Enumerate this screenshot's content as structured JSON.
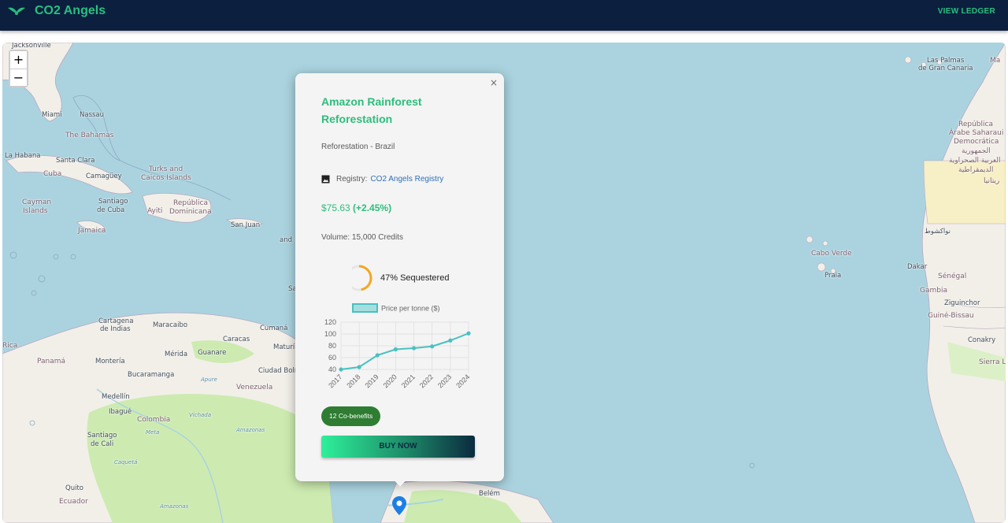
{
  "app": {
    "title": "CO2 Angels",
    "nav_link": "VIEW LEDGER",
    "brand_color": "#27c07f",
    "header_bg": "#0d1f3f"
  },
  "map": {
    "zoom_in": "+",
    "zoom_out": "−",
    "places": {
      "jacksonville": "Jacksonville",
      "miami": "Miami",
      "nassau": "Nassau",
      "bahamas": "The Bahamas",
      "la_habana": "La Habana",
      "santa_clara": "Santa Clara",
      "cuba": "Cuba",
      "camaguey": "Camagüey",
      "turks_1": "Turks and",
      "turks_2": "Caicos Islands",
      "cayman_1": "Cayman",
      "cayman_2": "Islands",
      "santiago_cuba_1": "Santiago",
      "santiago_cuba_2": "de Cuba",
      "jamaica": "Jamaica",
      "haiti": "Ayiti",
      "dominicana_1": "República",
      "dominicana_2": "Dominicana",
      "san_juan": "San Juan",
      "and": "and",
      "cartagena_1": "Cartagena",
      "cartagena_2": "de Indias",
      "maracaibo": "Maracaibo",
      "caracas": "Caracas",
      "cumana": "Cumaná",
      "panama": "Panamá",
      "rica": "Rica",
      "monteria": "Montería",
      "merida": "Mérida",
      "guanare": "Guanare",
      "maturin": "Maturín",
      "ciudad_bolivar": "Ciudad Bolív",
      "bucaramanga": "Bucaramanga",
      "apure": "Apure",
      "venezuela": "Venezuela",
      "medellin": "Medellín",
      "ibague": "Ibagué",
      "colombia": "Colombia",
      "vichada": "Vichada",
      "santiago_cali_1": "Santiago",
      "santiago_cali_2": "de Cali",
      "meta": "Meta",
      "amazonas": "Amazonas",
      "caqueta": "Caquetá",
      "quito": "Quito",
      "ecuador": "Ecuador",
      "amazonas_2": "Amazonas",
      "belem": "Belém",
      "las_palmas_1": "Las Palmas",
      "las_palmas_2": "de Gran Canaria",
      "ma": "Ma",
      "republica_1": "República",
      "republica_2": "Árabe Saharaui",
      "republica_3": "Democrática",
      "arabic_1": "الجمهورية",
      "arabic_2": "العربية الصحراوية",
      "arabic_3": "الديمقراطية",
      "arabic_4": "ريتانيا",
      "nouakchott": "نواكشوط",
      "cabo_verde": "Cabo Verde",
      "praia": "Praia",
      "dakar": "Dakar",
      "senegal": "Sénégal",
      "gambia": "Gambia",
      "ziguinchor": "Ziguinchor",
      "guine_bissau": "Guiné-Bissau",
      "conakry": "Conakry",
      "sierra_leo": "Sierra Le",
      "sa": "Sa"
    }
  },
  "popup": {
    "close": "×",
    "title": "Amazon Rainforest Reforestation",
    "subtitle": "Reforestation - Brazil",
    "registry_label": "Registry:",
    "registry_link": "CO2 Angels Registry",
    "price": "$75.63",
    "change": "(+2.45%)",
    "volume": "Volume: 15,000 Credits",
    "sequestered_pct": 47,
    "sequestered_label": "47% Sequestered",
    "cobenefits": "12 Co-benefits",
    "buy": "BUY NOW",
    "accent": "#2ebd7d",
    "progress_color": "#f5a623"
  },
  "chart_data": {
    "type": "line",
    "categories": [
      "2017",
      "2018",
      "2019",
      "2020",
      "2021",
      "2022",
      "2023",
      "2024"
    ],
    "series": [
      {
        "name": "Price per tonne ($)",
        "values": [
          40,
          44,
          64,
          74,
          76,
          79,
          89,
          101
        ]
      }
    ],
    "yticks": [
      "120",
      "100",
      "80",
      "60",
      "40"
    ],
    "ylim": [
      40,
      120
    ],
    "grid": true,
    "legend": "top",
    "color": "#4bc0c0"
  }
}
